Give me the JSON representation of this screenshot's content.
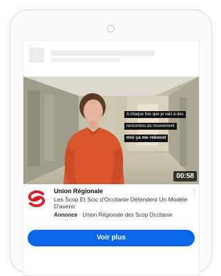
{
  "video": {
    "caption_line1": "A chaque fois que je vais à des",
    "caption_line2": "rencontres du mouvement",
    "caption_line3": "moi ça me reboost",
    "duration": "00:58"
  },
  "ad": {
    "advertiser": "Union Régionale",
    "title": "Les Scop Et Scic d'Occitanie Défendent Un Modèle D'avenir",
    "sponsored_label": "Annonce",
    "sponsor_separator": " · ",
    "sponsor_name": "Union Régionale des Scop Occitanie",
    "more_icon": "kebab-vertical-icon"
  },
  "cta": {
    "label": "Voir plus"
  },
  "colors": {
    "cta_blue": "#0a66e8",
    "logo_red": "#d3222f"
  }
}
